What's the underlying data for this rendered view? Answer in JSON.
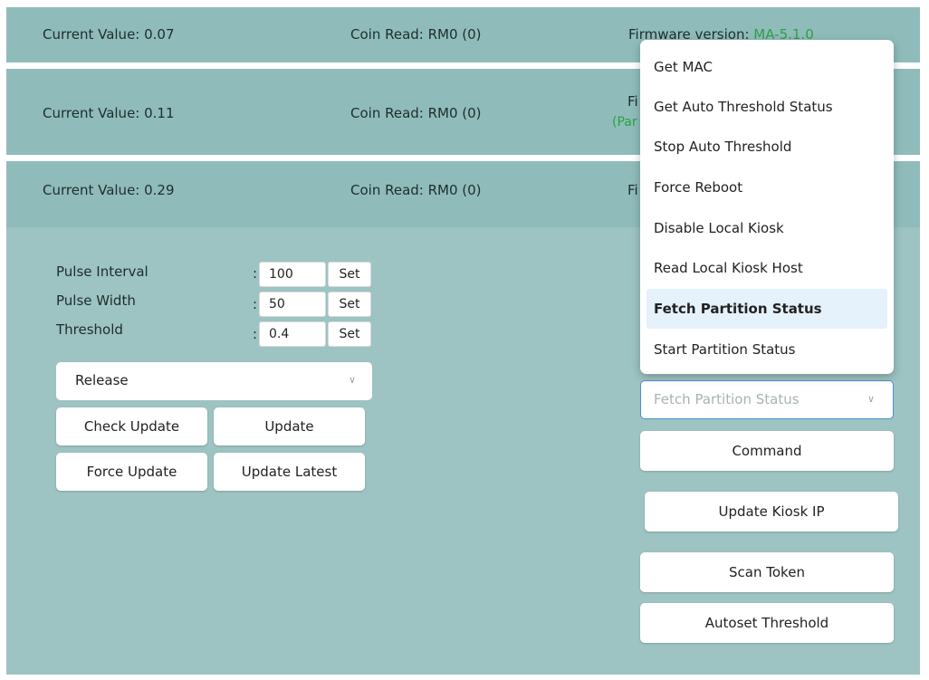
{
  "rows": [
    {
      "current_value": "Current Value: 0.07",
      "coin_read": "Coin Read: RM0 (0)",
      "firmware_label": "Firmware version: ",
      "firmware_value": "MA-5.1.0"
    },
    {
      "current_value": "Current Value: 0.11",
      "coin_read": "Coin Read: RM0 (0)",
      "firmware_fragment": "Fi",
      "partition_fragment": "(Par"
    },
    {
      "current_value": "Current Value: 0.29",
      "coin_read": "Coin Read: RM0 (0)",
      "firmware_fragment": "Fi"
    }
  ],
  "settings": [
    {
      "label": "Pulse Interval",
      "value": "100",
      "set_label": "Set"
    },
    {
      "label": "Pulse Width",
      "value": "50",
      "set_label": "Set"
    },
    {
      "label": "Threshold",
      "value": "0.4",
      "set_label": "Set"
    }
  ],
  "colon": ":",
  "release_select": {
    "value": "Release"
  },
  "buttons": {
    "check_update": "Check Update",
    "update": "Update",
    "force_update": "Force Update",
    "update_latest": "Update Latest",
    "command": "Command",
    "update_kiosk_ip": "Update Kiosk IP",
    "scan_token": "Scan Token",
    "autoset_threshold": "Autoset Threshold"
  },
  "command_select": {
    "value": "Fetch Partition Status"
  },
  "command_menu": {
    "items": [
      "Get MAC",
      "Get Auto Threshold Status",
      "Stop Auto Threshold",
      "Force Reboot",
      "Disable Local Kiosk",
      "Read Local Kiosk Host",
      "Fetch Partition Status",
      "Start Partition Status"
    ],
    "selected": "Fetch Partition Status"
  },
  "colors": {
    "row_bg": "#8fbcbb",
    "panel_bg": "#9dc3c2",
    "firmware_green": "#2ea043",
    "menu_highlight": "#e5f1fb"
  }
}
